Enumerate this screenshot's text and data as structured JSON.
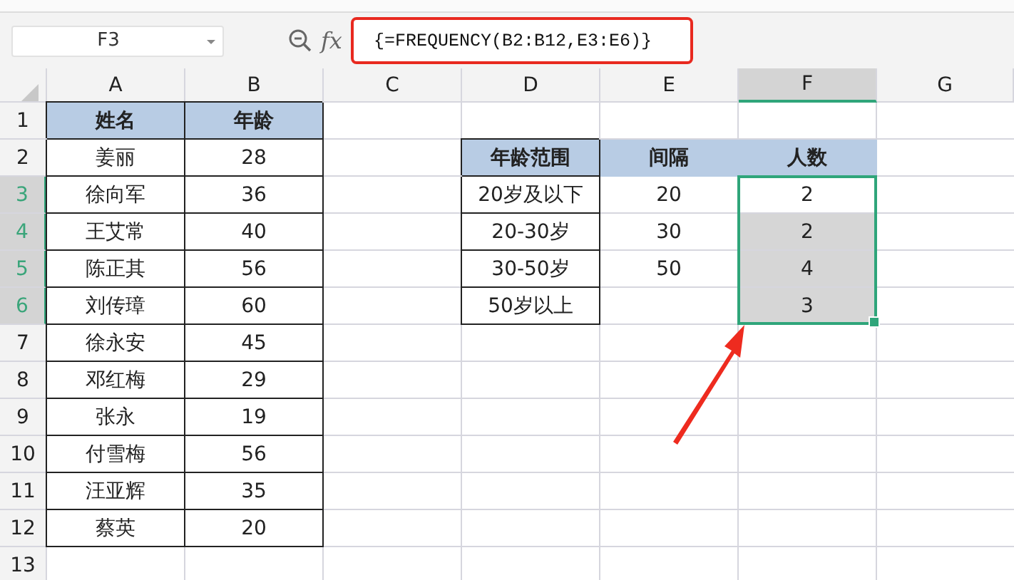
{
  "formula_bar": {
    "name_box": "F3",
    "function_button": "fx",
    "formula": "{=FREQUENCY(B2:B12,E3:E6)}"
  },
  "columns": [
    {
      "label": "A",
      "selected": false
    },
    {
      "label": "B",
      "selected": false
    },
    {
      "label": "C",
      "selected": false
    },
    {
      "label": "D",
      "selected": false
    },
    {
      "label": "E",
      "selected": false
    },
    {
      "label": "F",
      "selected": true
    },
    {
      "label": "G",
      "selected": false
    }
  ],
  "rows": [
    {
      "label": "1",
      "selected": false,
      "cells": {
        "A": {
          "text": "姓名",
          "kind": "title",
          "selected": false
        },
        "B": {
          "text": "年龄",
          "kind": "title",
          "selected": false
        }
      }
    },
    {
      "label": "2",
      "selected": false,
      "cells": {
        "A": {
          "text": "姜丽",
          "kind": "boxed",
          "selected": false
        },
        "B": {
          "text": "28",
          "kind": "boxed",
          "selected": false
        },
        "D": {
          "text": "年龄范围",
          "kind": "header_boxed",
          "selected": false
        },
        "E": {
          "text": "间隔",
          "kind": "header",
          "selected": false
        },
        "F": {
          "text": "人数",
          "kind": "header",
          "selected": false
        }
      }
    },
    {
      "label": "3",
      "selected": true,
      "cells": {
        "A": {
          "text": "徐向军",
          "kind": "boxed",
          "selected": false
        },
        "B": {
          "text": "36",
          "kind": "boxed",
          "selected": false
        },
        "D": {
          "text": "20岁及以下",
          "kind": "boxed",
          "selected": false
        },
        "E": {
          "text": "20",
          "kind": "plain",
          "selected": false
        },
        "F": {
          "text": "2",
          "kind": "plain",
          "selected": true,
          "active": true
        }
      }
    },
    {
      "label": "4",
      "selected": true,
      "cells": {
        "A": {
          "text": "王艾常",
          "kind": "boxed",
          "selected": false
        },
        "B": {
          "text": "40",
          "kind": "boxed",
          "selected": false
        },
        "D": {
          "text": "20-30岁",
          "kind": "boxed",
          "selected": false
        },
        "E": {
          "text": "30",
          "kind": "plain",
          "selected": false
        },
        "F": {
          "text": "2",
          "kind": "plain",
          "selected": true,
          "active": false
        }
      }
    },
    {
      "label": "5",
      "selected": true,
      "cells": {
        "A": {
          "text": "陈正其",
          "kind": "boxed",
          "selected": false
        },
        "B": {
          "text": "56",
          "kind": "boxed",
          "selected": false
        },
        "D": {
          "text": "30-50岁",
          "kind": "boxed",
          "selected": false
        },
        "E": {
          "text": "50",
          "kind": "plain",
          "selected": false
        },
        "F": {
          "text": "4",
          "kind": "plain",
          "selected": true,
          "active": false
        }
      }
    },
    {
      "label": "6",
      "selected": true,
      "cells": {
        "A": {
          "text": "刘传璋",
          "kind": "boxed",
          "selected": false
        },
        "B": {
          "text": "60",
          "kind": "boxed",
          "selected": false
        },
        "D": {
          "text": "50岁以上",
          "kind": "boxed",
          "selected": false
        },
        "F": {
          "text": "3",
          "kind": "plain",
          "selected": true,
          "active": false
        }
      }
    },
    {
      "label": "7",
      "selected": false,
      "cells": {
        "A": {
          "text": "徐永安",
          "kind": "boxed",
          "selected": false
        },
        "B": {
          "text": "45",
          "kind": "boxed",
          "selected": false
        }
      }
    },
    {
      "label": "8",
      "selected": false,
      "cells": {
        "A": {
          "text": "邓红梅",
          "kind": "boxed",
          "selected": false
        },
        "B": {
          "text": "29",
          "kind": "boxed",
          "selected": false
        }
      }
    },
    {
      "label": "9",
      "selected": false,
      "cells": {
        "A": {
          "text": "张永",
          "kind": "boxed",
          "selected": false
        },
        "B": {
          "text": "19",
          "kind": "boxed",
          "selected": false
        }
      }
    },
    {
      "label": "10",
      "selected": false,
      "cells": {
        "A": {
          "text": "付雪梅",
          "kind": "boxed",
          "selected": false
        },
        "B": {
          "text": "56",
          "kind": "boxed",
          "selected": false
        }
      }
    },
    {
      "label": "11",
      "selected": false,
      "cells": {
        "A": {
          "text": "汪亚辉",
          "kind": "boxed",
          "selected": false
        },
        "B": {
          "text": "35",
          "kind": "boxed",
          "selected": false
        }
      }
    },
    {
      "label": "12",
      "selected": false,
      "cells": {
        "A": {
          "text": "蔡英",
          "kind": "boxed",
          "selected": false
        },
        "B": {
          "text": "20",
          "kind": "boxed",
          "selected": false
        }
      }
    },
    {
      "label": "13",
      "selected": false,
      "cells": {}
    }
  ]
}
